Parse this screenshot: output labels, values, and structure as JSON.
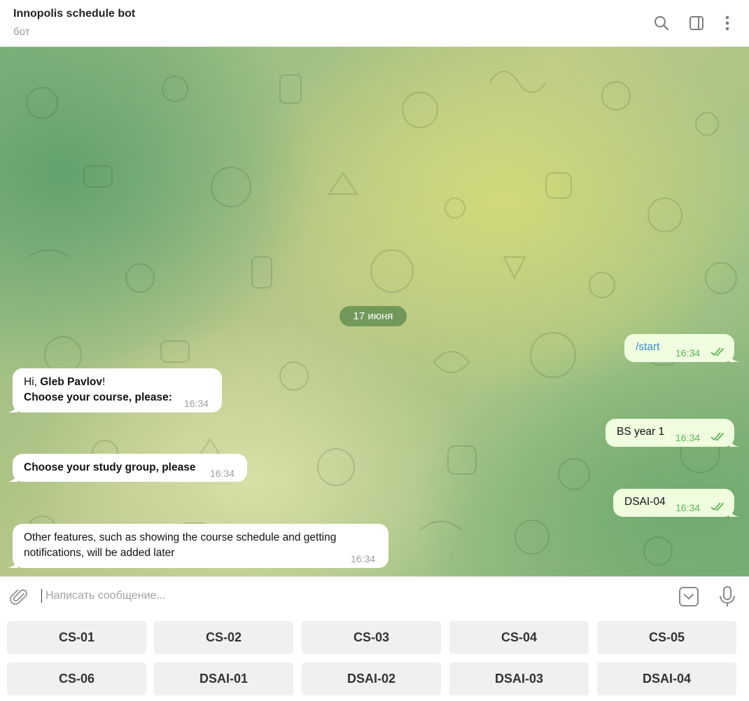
{
  "header": {
    "title": "Innopolis schedule bot",
    "subtitle": "бот"
  },
  "chat": {
    "date": "17 июня",
    "messages": {
      "m1": {
        "text": "/start",
        "time": "16:34"
      },
      "m2": {
        "prefix": "Hi, ",
        "name": "Gleb Pavlov",
        "suffix": "!",
        "line2": "Choose your course, please:",
        "time": "16:34"
      },
      "m3": {
        "text": "BS year 1",
        "time": "16:34"
      },
      "m4": {
        "text": "Choose your study group, please",
        "time": "16:34"
      },
      "m5": {
        "text": "DSAI-04",
        "time": "16:34"
      },
      "m6": {
        "line1": "Other features, such as showing the course schedule and getting",
        "line2": "notifications, will be added later",
        "time": "16:34"
      }
    }
  },
  "composer": {
    "placeholder": "Написать сообщение..."
  },
  "keyboard": {
    "buttons": [
      "CS-01",
      "CS-02",
      "CS-03",
      "CS-04",
      "CS-05",
      "CS-06",
      "DSAI-01",
      "DSAI-02",
      "DSAI-03",
      "DSAI-04"
    ]
  },
  "colors": {
    "outgoing_bubble": "#effdde",
    "incoming_bubble": "#ffffff",
    "command_link": "#3a8bc9",
    "read_ticks": "#5fb35a"
  },
  "icons": [
    "search-icon",
    "sidebar-toggle-icon",
    "more-vertical-icon",
    "paperclip-icon",
    "keyboard-toggle-icon",
    "microphone-icon"
  ]
}
